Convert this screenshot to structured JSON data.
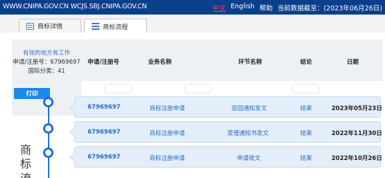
{
  "topbar": {
    "site": "WWW.CNIPA.GOV.CN WCJS.SBJ.CNIPA.GOV.CN",
    "lang_zh": "中文",
    "lang_en": "English",
    "help": "帮助",
    "data_cutoff": "当前数据截至：(2023年06月26日)"
  },
  "tabs": [
    {
      "label": "商标详情",
      "icon": "document-list-icon"
    },
    {
      "label": "商标流程",
      "icon": "flow-list-icon"
    }
  ],
  "info": {
    "pending_text": "有效的地方有工作",
    "reg_no": "申请/注册号：67969697",
    "intl_class": "国际分类：41"
  },
  "table_header": {
    "reg_no": "申请/注册号",
    "biz_name": "业务名称",
    "step_name": "环节名称",
    "result": "结论",
    "date": "日期"
  },
  "print_label": "打印",
  "side_label": [
    "商",
    "标",
    "流"
  ],
  "rows": [
    {
      "reg_no": "67969697",
      "biz_name": "商标注册申请",
      "step_name": "驳回通知发文",
      "result": "结束",
      "date": "2023年05月23日"
    },
    {
      "reg_no": "67969697",
      "biz_name": "商标注册申请",
      "step_name": "受理通知书发文",
      "result": "结束",
      "date": "2022年11月30日"
    },
    {
      "reg_no": "67969697",
      "biz_name": "商标注册申请",
      "step_name": "申请收文",
      "result": "结束",
      "date": "2022年10月26日"
    }
  ],
  "colors": {
    "topbar_bg": "#0a3f8c",
    "accent": "#1f6fd1",
    "row_bg": "#e3eef8",
    "link": "#2d6bc4"
  }
}
